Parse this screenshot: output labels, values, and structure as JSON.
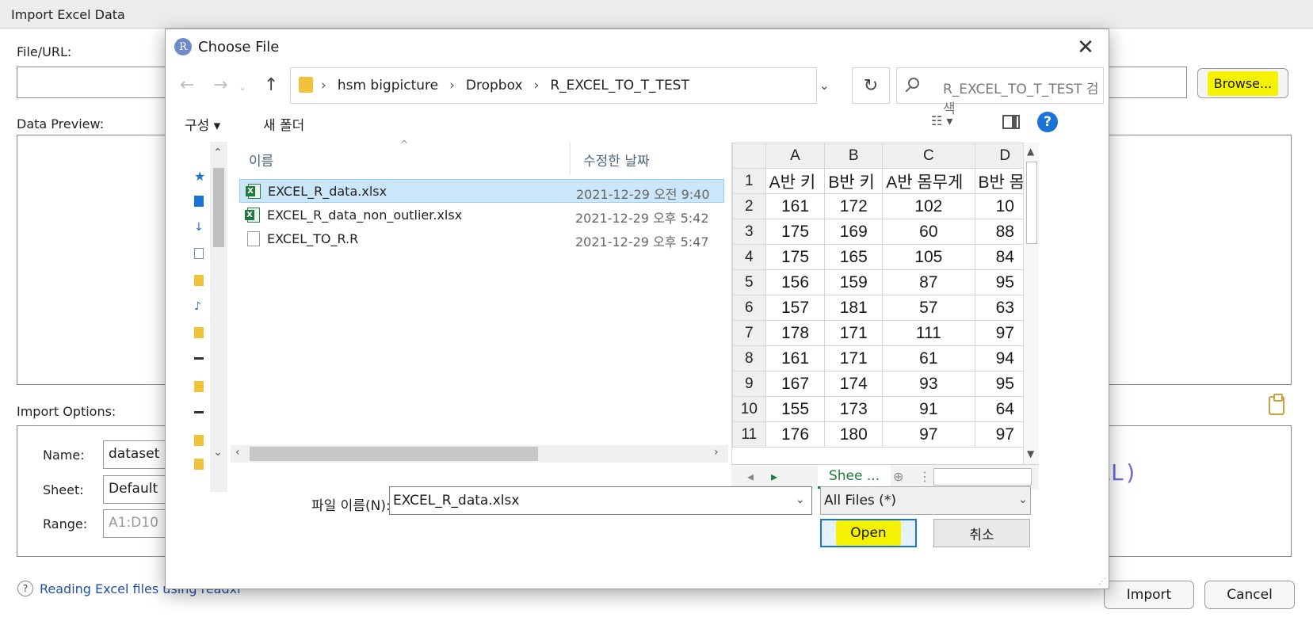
{
  "bg_dialog": {
    "title": "Import Excel Data",
    "file_url_label": "File/URL:",
    "browse_label": "Browse...",
    "data_preview_label": "Data Preview:",
    "import_options_label": "Import Options:",
    "name_label": "Name:",
    "name_value": "dataset",
    "sheet_label": "Sheet:",
    "sheet_value": "Default",
    "range_label": "Range:",
    "range_placeholder": "A1:D10",
    "help_link": "Reading Excel files using readxl",
    "code_fragment": "LL)",
    "import_button": "Import",
    "cancel_button": "Cancel",
    "highlight_color": "#f4f200"
  },
  "dialog": {
    "title": "Choose File",
    "breadcrumbs": [
      "hsm bigpicture",
      "Dropbox",
      "R_EXCEL_TO_T_TEST"
    ],
    "search_placeholder": "R_EXCEL_TO_T_TEST 검색",
    "organize_label": "구성 ▾",
    "new_folder_label": "새 폴더",
    "view_label": "☷ ▾",
    "help_label": "?",
    "columns": {
      "name": "이름",
      "date": "수정한 날짜"
    },
    "files": [
      {
        "name": "EXCEL_R_data.xlsx",
        "date": "2021-12-29 오전 9:40",
        "type": "excel",
        "selected": true
      },
      {
        "name": "EXCEL_R_data_non_outlier.xlsx",
        "date": "2021-12-29 오후 5:42",
        "type": "excel",
        "selected": false
      },
      {
        "name": "EXCEL_TO_R.R",
        "date": "2021-12-29 오후 5:47",
        "type": "r",
        "selected": false
      }
    ],
    "preview": {
      "col_headers": [
        "A",
        "B",
        "C",
        "D"
      ],
      "rows": [
        {
          "n": "1",
          "cells": [
            "A반 키",
            "B반 키",
            "A반 몸무게",
            "B반 몸"
          ]
        },
        {
          "n": "2",
          "cells": [
            "161",
            "172",
            "102",
            "10"
          ]
        },
        {
          "n": "3",
          "cells": [
            "175",
            "169",
            "60",
            "88"
          ]
        },
        {
          "n": "4",
          "cells": [
            "175",
            "165",
            "105",
            "84"
          ]
        },
        {
          "n": "5",
          "cells": [
            "156",
            "159",
            "87",
            "95"
          ]
        },
        {
          "n": "6",
          "cells": [
            "157",
            "181",
            "57",
            "63"
          ]
        },
        {
          "n": "7",
          "cells": [
            "178",
            "171",
            "111",
            "97"
          ]
        },
        {
          "n": "8",
          "cells": [
            "161",
            "171",
            "61",
            "94"
          ]
        },
        {
          "n": "9",
          "cells": [
            "167",
            "174",
            "93",
            "95"
          ]
        },
        {
          "n": "10",
          "cells": [
            "155",
            "173",
            "91",
            "64"
          ]
        },
        {
          "n": "11",
          "cells": [
            "176",
            "180",
            "97",
            "97"
          ]
        }
      ],
      "sheet_tab": "Shee ..."
    },
    "filename_label": "파일 이름(N):",
    "filename_value": "EXCEL_R_data.xlsx",
    "filetype_value": "All Files  (*)",
    "open_label": "Open",
    "cancel_label": "취소",
    "accent_color": "#1a73d9"
  }
}
